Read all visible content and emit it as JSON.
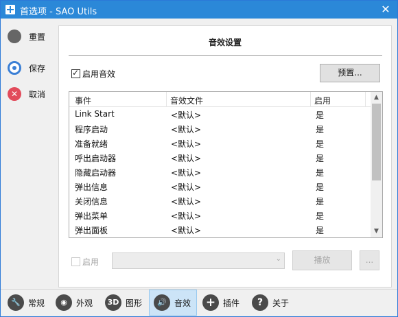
{
  "window": {
    "title": "首选项 - SAO Utils",
    "close_glyph": "✕"
  },
  "sidebar": {
    "items": [
      {
        "label": "重置",
        "icon": "reset-icon"
      },
      {
        "label": "保存",
        "icon": "save-icon"
      },
      {
        "label": "取消",
        "icon": "cancel-icon"
      }
    ],
    "cancel_glyph": "✕"
  },
  "panel": {
    "title": "音效设置",
    "enable_sfx": {
      "label": "启用音效",
      "checked": true
    },
    "preset_button": "预置...",
    "columns": [
      "事件",
      "音效文件",
      "启用"
    ],
    "rows": [
      {
        "event": "Link Start",
        "file": "<默认>",
        "enabled": "是"
      },
      {
        "event": "程序启动",
        "file": "<默认>",
        "enabled": "是"
      },
      {
        "event": "准备就绪",
        "file": "<默认>",
        "enabled": "是"
      },
      {
        "event": "呼出启动器",
        "file": "<默认>",
        "enabled": "是"
      },
      {
        "event": "隐藏启动器",
        "file": "<默认>",
        "enabled": "是"
      },
      {
        "event": "弹出信息",
        "file": "<默认>",
        "enabled": "是"
      },
      {
        "event": "关闭信息",
        "file": "<默认>",
        "enabled": "是"
      },
      {
        "event": "弹出菜单",
        "file": "<默认>",
        "enabled": "是"
      },
      {
        "event": "弹出面板",
        "file": "<默认>",
        "enabled": "是"
      }
    ],
    "scroll_up_glyph": "▲",
    "scroll_down_glyph": "▼",
    "enable_label": "启用",
    "enable_checked": false,
    "sound_select_value": "",
    "combo_arrow_glyph": "⌄",
    "play_button": "播放",
    "browse_button": "..."
  },
  "tabs": [
    {
      "label": "常规",
      "icon": "wrench-icon",
      "glyph": "🔧",
      "active": false
    },
    {
      "label": "外观",
      "icon": "eye-icon",
      "glyph": "◉",
      "active": false
    },
    {
      "label": "图形",
      "icon": "3d-icon",
      "glyph": "3D",
      "active": false
    },
    {
      "label": "音效",
      "icon": "speaker-icon",
      "glyph": "🔊",
      "active": true
    },
    {
      "label": "插件",
      "icon": "plus-icon",
      "glyph": "+",
      "active": false
    },
    {
      "label": "关于",
      "icon": "help-icon",
      "glyph": "?",
      "active": false
    }
  ],
  "colors": {
    "titlebar": "#2b88d8",
    "active_tab": "#cce4f7",
    "cancel_red": "#e24b5b",
    "save_blue": "#3a7fd5"
  }
}
